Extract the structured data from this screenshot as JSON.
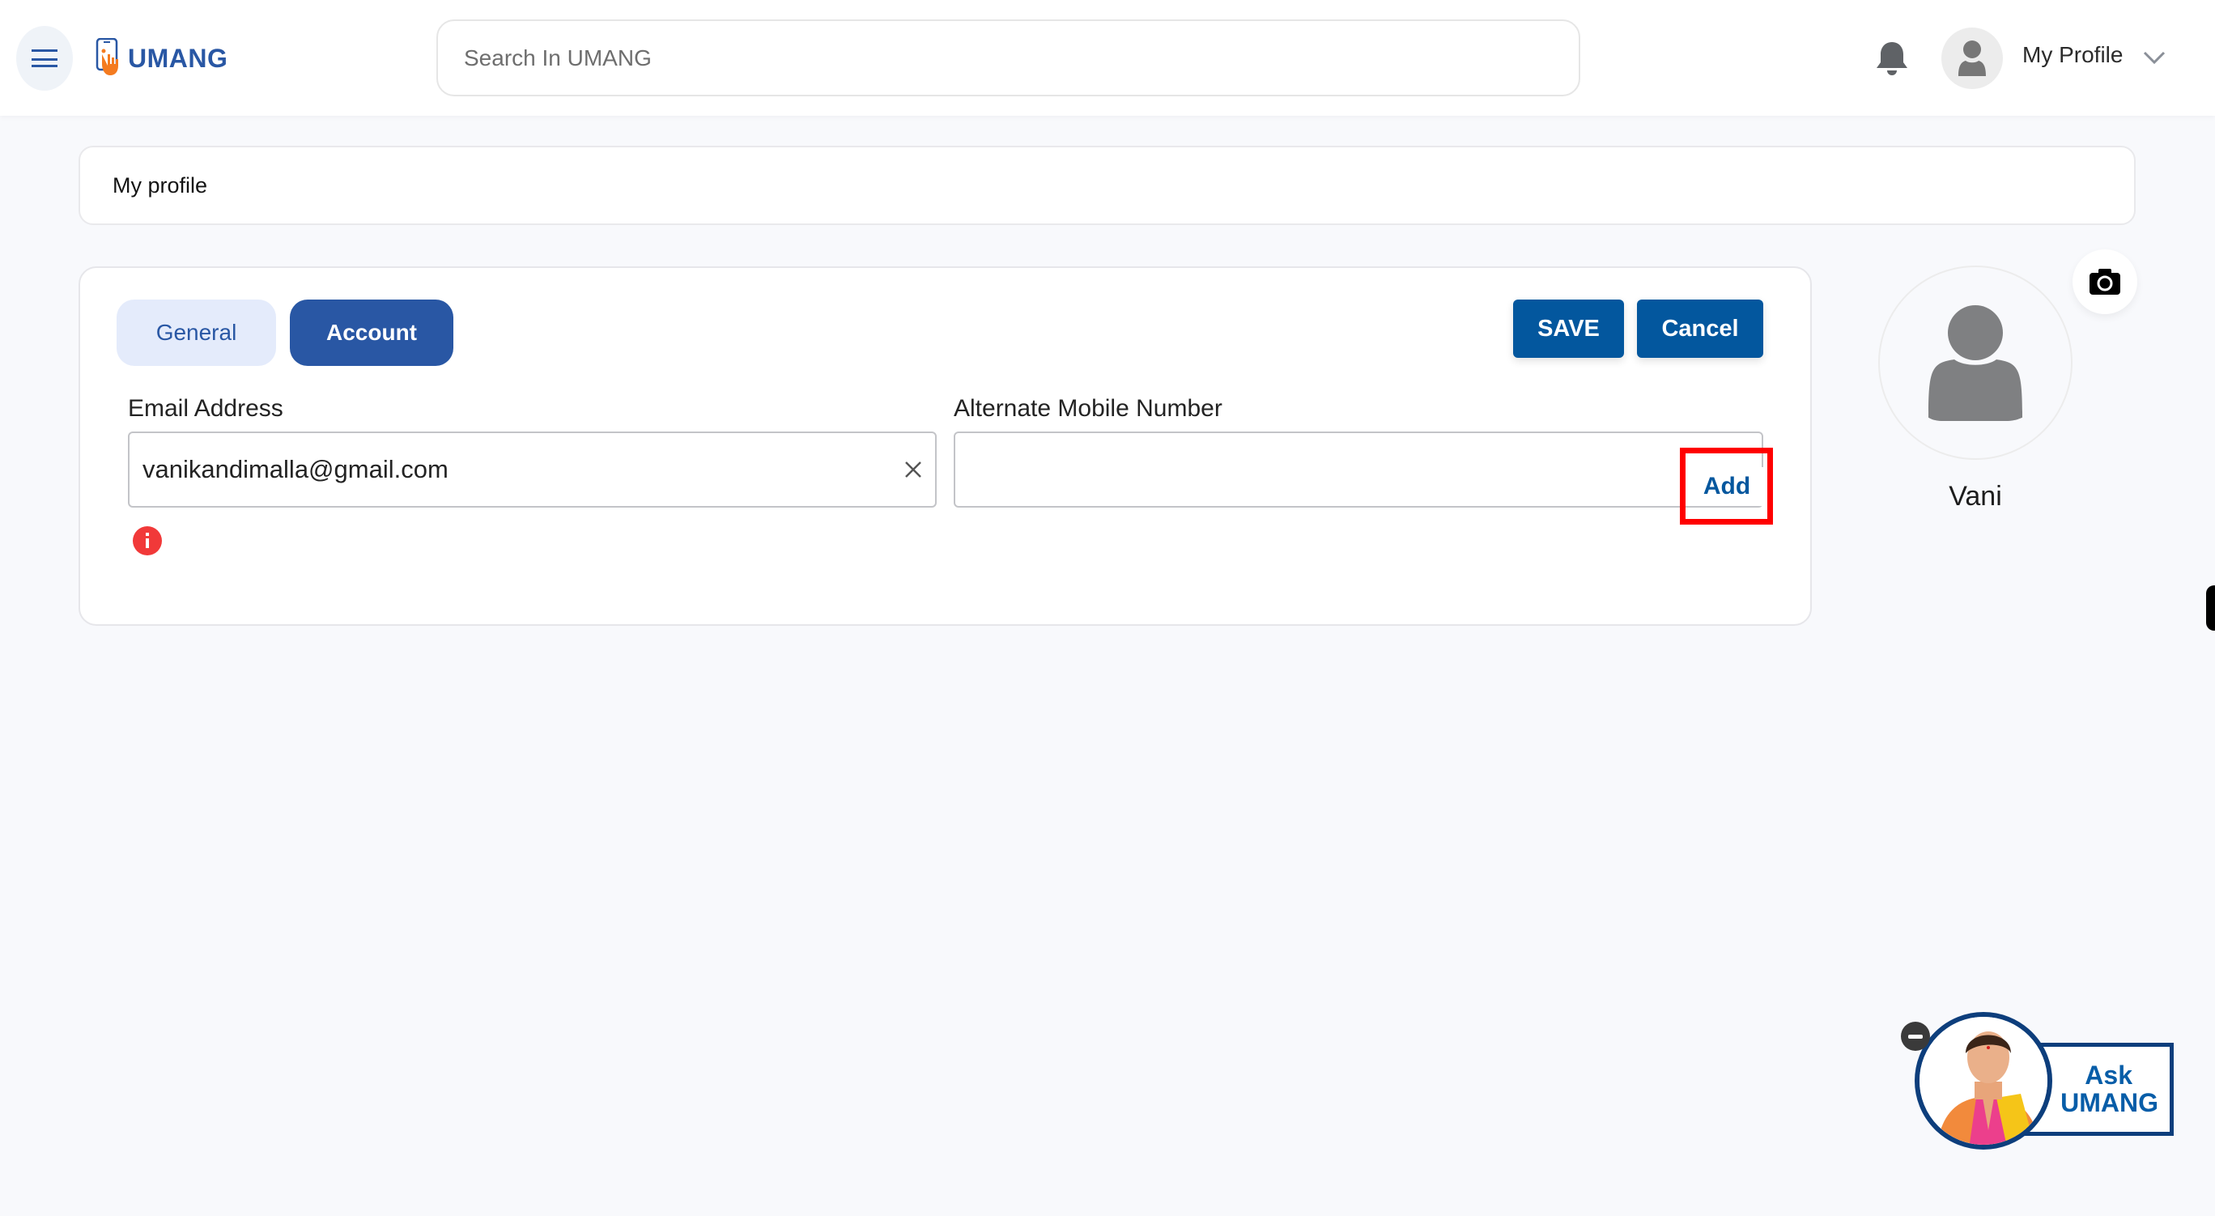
{
  "header": {
    "brand": "UMANG",
    "search_placeholder": "Search In UMANG",
    "search_value": "",
    "profile_label": "My Profile"
  },
  "breadcrumb": {
    "title": "My profile"
  },
  "tabs": [
    {
      "label": "General",
      "active": false
    },
    {
      "label": "Account",
      "active": true
    }
  ],
  "actions": {
    "save_label": "SAVE",
    "cancel_label": "Cancel"
  },
  "fields": {
    "email": {
      "label": "Email Address",
      "value": "vanikandimalla@gmail.com"
    },
    "alternate_mobile": {
      "label": "Alternate Mobile Number",
      "value": "",
      "add_label": "Add"
    }
  },
  "profile": {
    "name": "Vani"
  },
  "assistant": {
    "line1": "Ask",
    "line2": "UMANG"
  },
  "colors": {
    "brand_blue": "#2957a4",
    "button_blue": "#03579e",
    "brand_orange": "#f47b20",
    "error_red": "#f13939",
    "highlight_red": "#ff0000"
  }
}
